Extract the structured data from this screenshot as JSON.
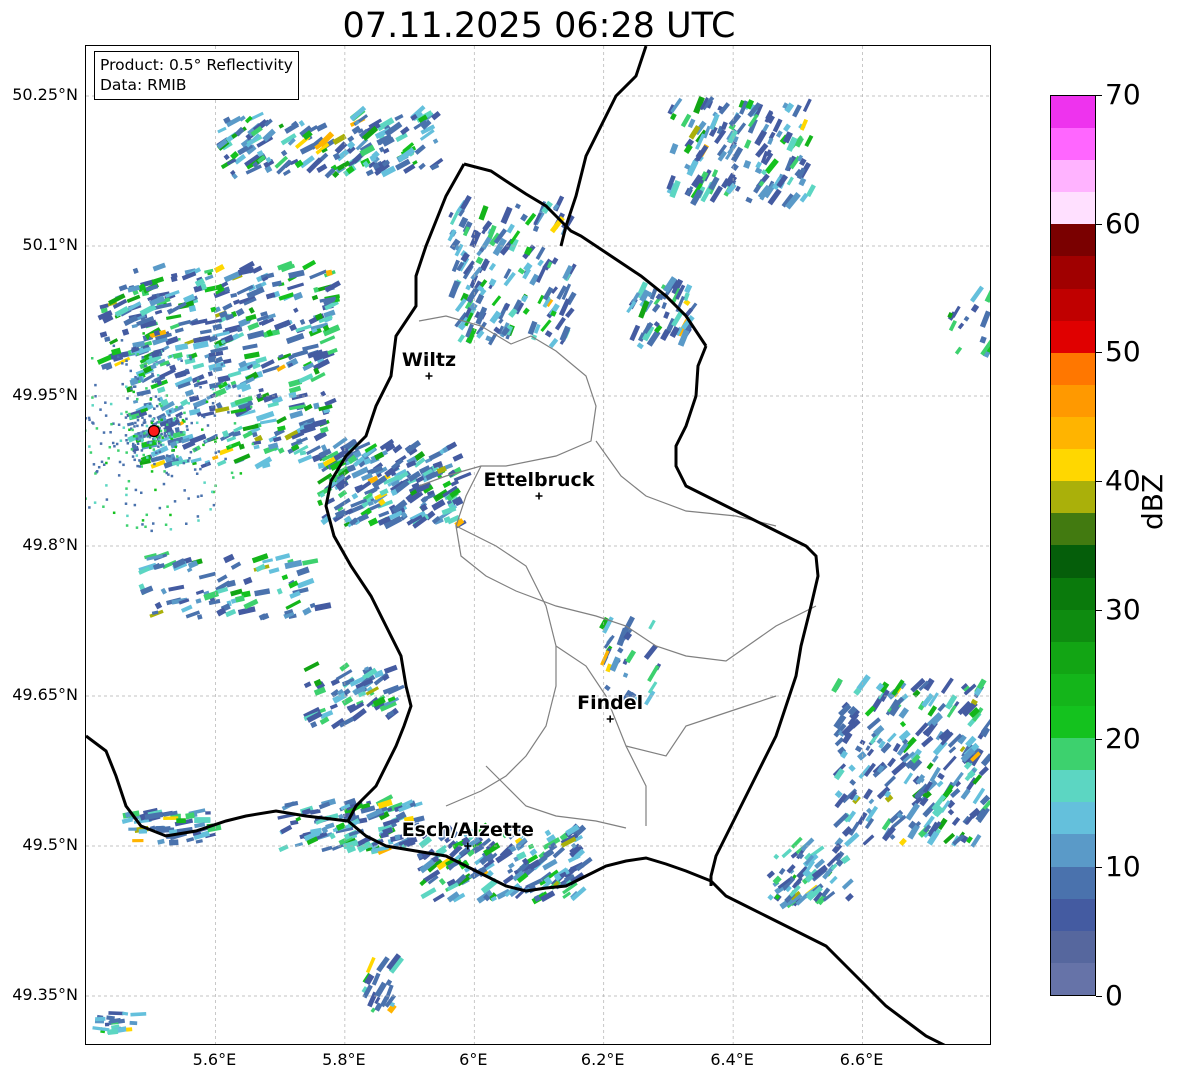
{
  "title": "07.11.2025 06:28 UTC",
  "info": {
    "product": "Product: 0.5° Reflectivity",
    "data": "Data: RMIB"
  },
  "map": {
    "extent": {
      "lon_min": 5.4,
      "lon_max": 6.8,
      "lat_min": 49.3,
      "lat_max": 50.3
    },
    "latitude_labels": [
      "50.25°N",
      "50.1°N",
      "49.95°N",
      "49.8°N",
      "49.65°N",
      "49.5°N",
      "49.35°N"
    ],
    "latitude_values": [
      50.25,
      50.1,
      49.95,
      49.8,
      49.65,
      49.5,
      49.35
    ],
    "longitude_labels": [
      "5.6°E",
      "5.8°E",
      "6°E",
      "6.2°E",
      "6.4°E",
      "6.6°E"
    ],
    "longitude_values": [
      5.6,
      5.8,
      6.0,
      6.2,
      6.4,
      6.6
    ],
    "radar_site": {
      "lon": 5.505,
      "lat": 49.915,
      "color": "#ff1a1a"
    },
    "cities": [
      {
        "name": "Wiltz",
        "lon": 5.93,
        "lat": 49.97
      },
      {
        "name": "Ettelbruck",
        "lon": 6.1,
        "lat": 49.85
      },
      {
        "name": "Findel",
        "lon": 6.21,
        "lat": 49.627
      },
      {
        "name": "Esch/Alzette",
        "lon": 5.99,
        "lat": 49.5
      }
    ],
    "colors": {
      "border": "#000000",
      "cantons": "#808080",
      "grid": "#b0b0b0"
    }
  },
  "colorbar": {
    "label": "dBZ",
    "tick_labels": [
      "0",
      "10",
      "20",
      "30",
      "40",
      "50",
      "60",
      "70"
    ],
    "tick_values": [
      0,
      10,
      20,
      30,
      40,
      50,
      60,
      70
    ],
    "min": 0,
    "max": 70,
    "step": 2.5,
    "colors": [
      "#6673a8",
      "#56679e",
      "#445ba1",
      "#4a72ad",
      "#5a9ac8",
      "#64c0dc",
      "#5cd6c2",
      "#3dd16e",
      "#14c21e",
      "#14b51a",
      "#12a514",
      "#0e8c10",
      "#0a7a0c",
      "#055e0a",
      "#427a10",
      "#aab00a",
      "#ffd700",
      "#ffb400",
      "#ff9900",
      "#ff7700",
      "#e00000",
      "#c00000",
      "#a00000",
      "#7a0000",
      "#ffe0ff",
      "#ffb3ff",
      "#ff66ff",
      "#ee33ee"
    ]
  }
}
